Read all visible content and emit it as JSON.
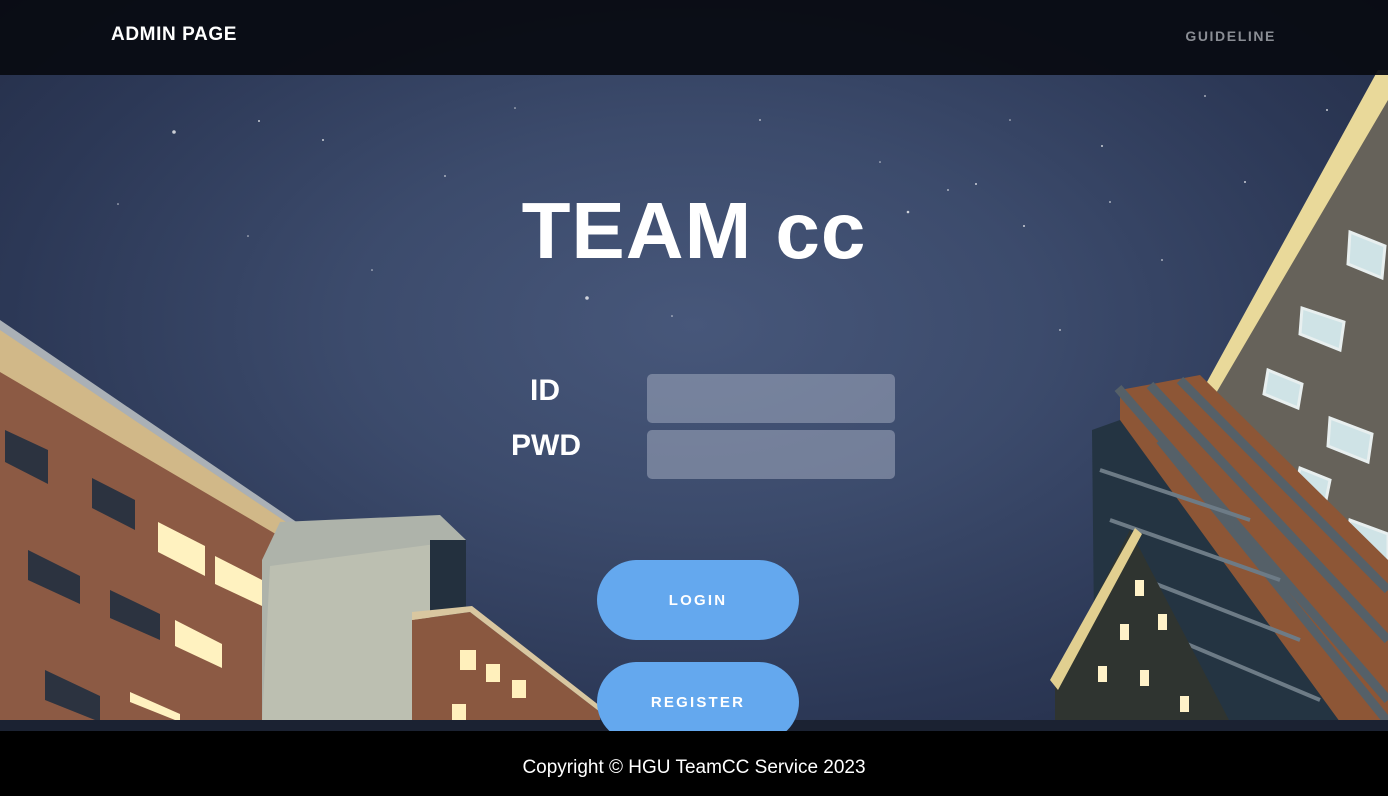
{
  "navbar": {
    "brand": "ADMIN PAGE",
    "guideline_link": "GUIDELINE"
  },
  "hero": {
    "background_image": "night-campus-buildings-photo",
    "title": "TEAM cc"
  },
  "login_form": {
    "id_label": "ID",
    "id_value": "",
    "pwd_label": "PWD",
    "pwd_value": "",
    "login_button": "LOGIN",
    "register_button": "REGISTER"
  },
  "footer": {
    "copyright": "Copyright © HGU TeamCC Service 2023"
  },
  "colors": {
    "navbar_bg": "#0a0d14",
    "sky": "#3c4b6c",
    "button": "#64a8ee",
    "footer_bg": "#000000",
    "text": "#ffffff",
    "guideline_text": "#8a8d94"
  }
}
